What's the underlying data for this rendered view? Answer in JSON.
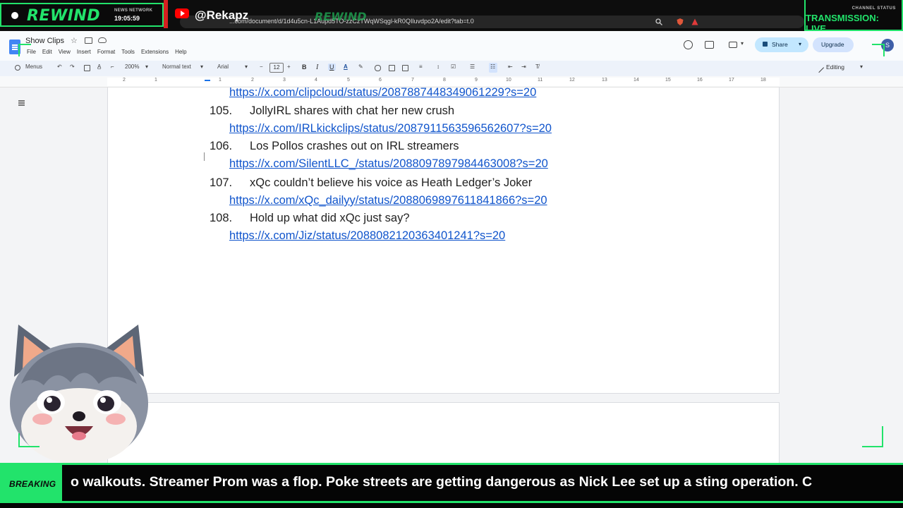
{
  "overlay": {
    "brand": "REWIND",
    "network_label": "NEWS NETWORK",
    "time": "19:05:59",
    "handle": "@Rekapz",
    "url_fragment": "...com/document/d/1d4u5cn-L1Aupd5TO-zzCzTWqWSqgl-kR0QIluvdpo2A/edit?tab=t.0",
    "watermark": "REWIND",
    "channel_status_label": "CHANNEL STATUS",
    "channel_status_value": "TRANSMISSION: LIVE",
    "accent_color": "#22e36b",
    "ticker_label": "BREAKING",
    "ticker_text": "o walkouts. Streamer Prom was a flop. Poke streets are getting dangerous as Nick Lee set up a sting operation. C"
  },
  "docs": {
    "title": "Show Clips",
    "menu": [
      "File",
      "Edit",
      "View",
      "Insert",
      "Format",
      "Tools",
      "Extensions",
      "Help"
    ],
    "share_label": "Share",
    "upgrade_label": "Upgrade",
    "avatar_letter": "S",
    "toolbar": {
      "menus_label": "Menus",
      "zoom": "200%",
      "style": "Normal text",
      "font": "Arial",
      "font_size": "12",
      "bold": "B",
      "italic": "I",
      "underline": "U",
      "text_color": "A",
      "editing_label": "Editing"
    },
    "ruler_numbers": [
      "2",
      "1",
      "1",
      "2",
      "3",
      "4",
      "5",
      "6",
      "7",
      "8",
      "9",
      "10",
      "11",
      "12",
      "13",
      "14",
      "15",
      "16",
      "17",
      "18"
    ]
  },
  "document": {
    "top_link": "https://x.com/clipcloud/status/2087887448349061229?s=20",
    "items": [
      {
        "number": "105.",
        "title": "JollyIRL shares with chat her new crush",
        "link": "https://x.com/IRLkickclips/status/2087911563596562607?s=20"
      },
      {
        "number": "106.",
        "title": "Los Pollos crashes out on IRL streamers",
        "link": "https://x.com/SilentLLC_/status/2088097897984463008?s=20"
      },
      {
        "number": "107.",
        "title": "xQc couldn’t believe his voice as Heath Ledger’s Joker",
        "link": "https://x.com/xQc_dailyy/status/2088069897611841866?s=20"
      },
      {
        "number": "108.",
        "title": "Hold up what did xQc just say?",
        "link": "https://x.com/Jiz/status/2088082120363401241?s=20"
      }
    ]
  }
}
